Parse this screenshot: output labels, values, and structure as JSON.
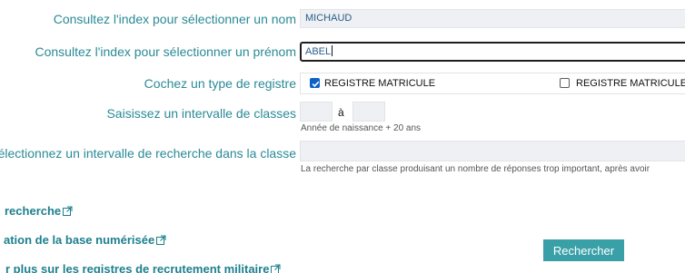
{
  "form": {
    "nom": {
      "label": "Consultez l'index pour sélectionner un nom",
      "value": "MICHAUD"
    },
    "prenom": {
      "label": "Consultez l'index pour sélectionner un prénom",
      "value": "ABEL"
    },
    "registre": {
      "label": "Cochez un type de registre",
      "options": [
        {
          "label": "REGISTRE MATRICULE",
          "checked": true
        },
        {
          "label": "REGISTRE MATRICULE",
          "checked": false
        }
      ]
    },
    "classes": {
      "label": "Saisissez un intervalle de classes",
      "separator": "à",
      "hint": "Année de naissance + 20 ans"
    },
    "recherche_classe": {
      "label": "électionnez un intervalle de recherche dans la classe",
      "hint": "La recherche par classe produisant un nombre de réponses trop important, après avoir"
    }
  },
  "links": [
    {
      "label": "recherche"
    },
    {
      "label": "ation de la base numérisée"
    },
    {
      "label": "r plus sur les registres de recrutement militaire"
    }
  ],
  "submit_label": "Rechercher",
  "colors": {
    "label": "#2a8a96",
    "link": "#1d7f8e",
    "button": "#3aa0a8",
    "checkbox": "#0b63c8"
  }
}
